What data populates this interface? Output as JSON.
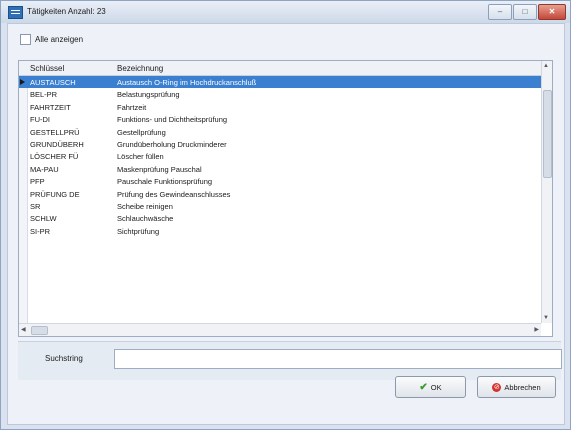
{
  "window": {
    "title": "Tätigkeiten  Anzahl: 23"
  },
  "filter": {
    "show_all_label": "Alle anzeigen",
    "show_all_checked": false
  },
  "grid": {
    "columns": [
      "Schlüssel",
      "Bezeichnung"
    ],
    "selected_index": 0,
    "rows": [
      [
        "AUSTAUSCH",
        "Austausch O-Ring im Hochdruckanschluß"
      ],
      [
        "BEL-PR",
        "Belastungsprüfung"
      ],
      [
        "FAHRTZEIT",
        "Fahrtzeit"
      ],
      [
        "FU-DI",
        "Funktions- und Dichtheitsprüfung"
      ],
      [
        "GESTELLPRÜ",
        "Gestellprüfung"
      ],
      [
        "GRUNDÜBERH",
        "Grundüberholung Druckminderer"
      ],
      [
        "LÖSCHER FÜ",
        "Löscher füllen"
      ],
      [
        "MA-PAU",
        "Maskenprüfung Pauschal"
      ],
      [
        "PFP",
        "Pauschale Funktionsprüfung"
      ],
      [
        "PRÜFUNG DE",
        "Prüfung des Gewindeanschlusses"
      ],
      [
        "SR",
        "Scheibe reinigen"
      ],
      [
        "SCHLW",
        "Schlauchwäsche"
      ],
      [
        "SI-PR",
        "Sichtprüfung"
      ]
    ]
  },
  "search": {
    "label": "Suchstring",
    "value": ""
  },
  "buttons": {
    "ok": "OK",
    "cancel": "Abbrechen"
  }
}
